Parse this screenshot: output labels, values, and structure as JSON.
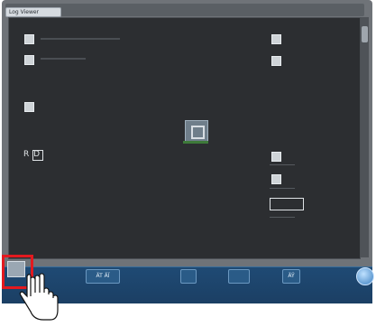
{
  "window": {
    "title": "Log Viewer"
  },
  "canvas_labels": {
    "left_mid_label": "R D"
  },
  "toolbar": {
    "button_1": "ÄT ÄÏ",
    "button_2": "",
    "button_3": "",
    "button_4": "ÄŸ",
    "button_5": ""
  },
  "colors": {
    "highlight": "#e3191f",
    "toolbar": "#1f4a74",
    "canvas": "#2c2e31"
  },
  "icons": {
    "left_top_1": "grid-icon",
    "left_top_2": "grid-icon",
    "left_mid": "square-icon",
    "center": "target-icon",
    "right_top_1": "grid-icon",
    "right_top_2": "grid-icon",
    "right_mid_1": "square-icon",
    "right_mid_2": "lock-icon",
    "right_mid_3": "checkbox-icon",
    "bottom_left_selected": "tile-icon",
    "bottom_right_orb": "orb-icon",
    "hand_pointer": "hand-pointer-icon"
  }
}
